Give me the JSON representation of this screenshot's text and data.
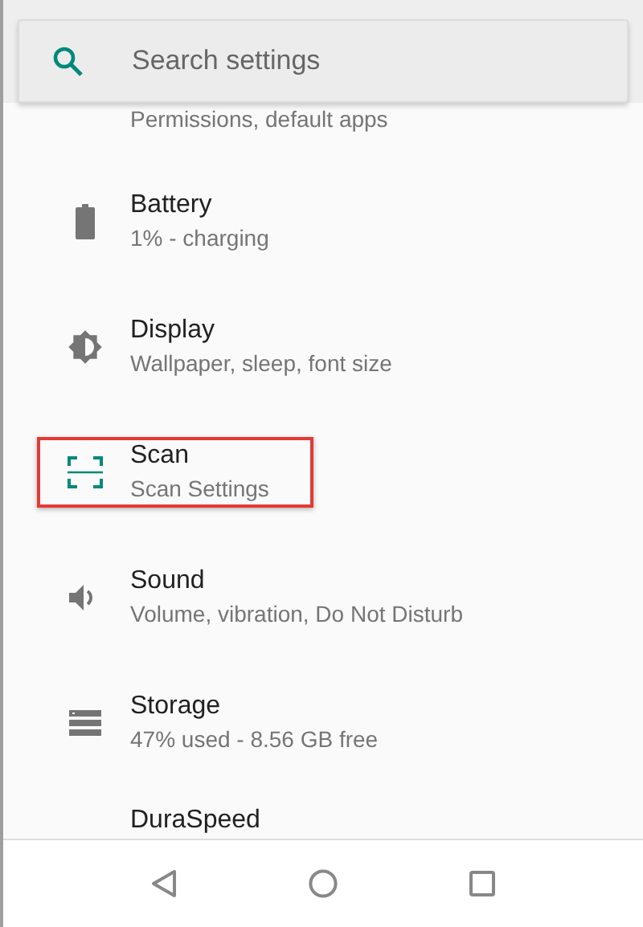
{
  "search": {
    "placeholder": "Search settings"
  },
  "items": [
    {
      "kind": "partial",
      "subtitle": "Permissions, default apps"
    },
    {
      "kind": "battery",
      "title": "Battery",
      "subtitle": "1% - charging",
      "highlighted": false
    },
    {
      "kind": "display",
      "title": "Display",
      "subtitle": "Wallpaper, sleep, font size",
      "highlighted": false
    },
    {
      "kind": "scan",
      "title": "Scan",
      "subtitle": "Scan Settings",
      "highlighted": true
    },
    {
      "kind": "sound",
      "title": "Sound",
      "subtitle": "Volume, vibration, Do Not Disturb",
      "highlighted": false
    },
    {
      "kind": "storage",
      "title": "Storage",
      "subtitle": "47% used - 8.56 GB free",
      "highlighted": false
    },
    {
      "kind": "cut",
      "title": "DuraSpeed"
    }
  ],
  "nav": [
    {
      "kind": "back"
    },
    {
      "kind": "home"
    },
    {
      "kind": "recents"
    }
  ]
}
